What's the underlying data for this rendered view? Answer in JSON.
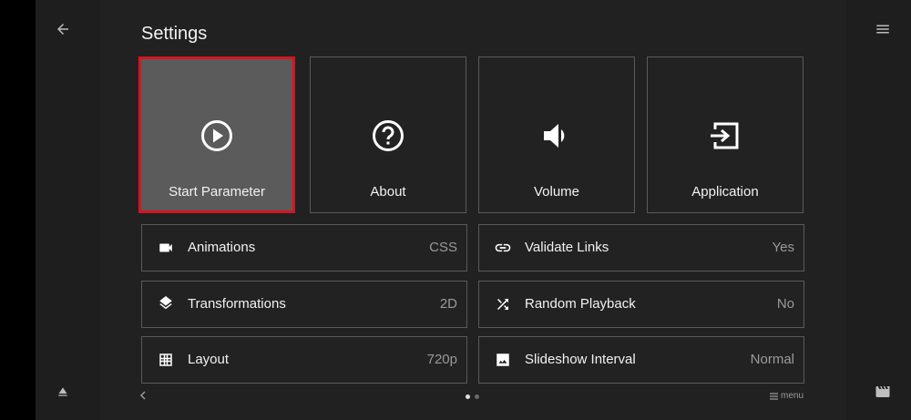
{
  "page_title": "Settings",
  "tiles": [
    {
      "label": "Start Parameter",
      "icon": "play-circle-icon",
      "selected": true
    },
    {
      "label": "About",
      "icon": "help-circle-icon"
    },
    {
      "label": "Volume",
      "icon": "volume-icon"
    },
    {
      "label": "Application",
      "icon": "exit-app-icon"
    }
  ],
  "rows": [
    {
      "label": "Animations",
      "value": "CSS",
      "icon": "videocam-icon"
    },
    {
      "label": "Validate Links",
      "value": "Yes",
      "icon": "link-icon"
    },
    {
      "label": "Transformations",
      "value": "2D",
      "icon": "layers-icon"
    },
    {
      "label": "Random Playback",
      "value": "No",
      "icon": "shuffle-icon"
    },
    {
      "label": "Layout",
      "value": "720p",
      "icon": "grid-icon"
    },
    {
      "label": "Slideshow Interval",
      "value": "Normal",
      "icon": "image-icon"
    }
  ],
  "footer": {
    "menu_label": "menu",
    "page_count": 2,
    "current_page": 1
  },
  "colors": {
    "accent_selected_border": "#d7141e",
    "background": "#212121"
  }
}
